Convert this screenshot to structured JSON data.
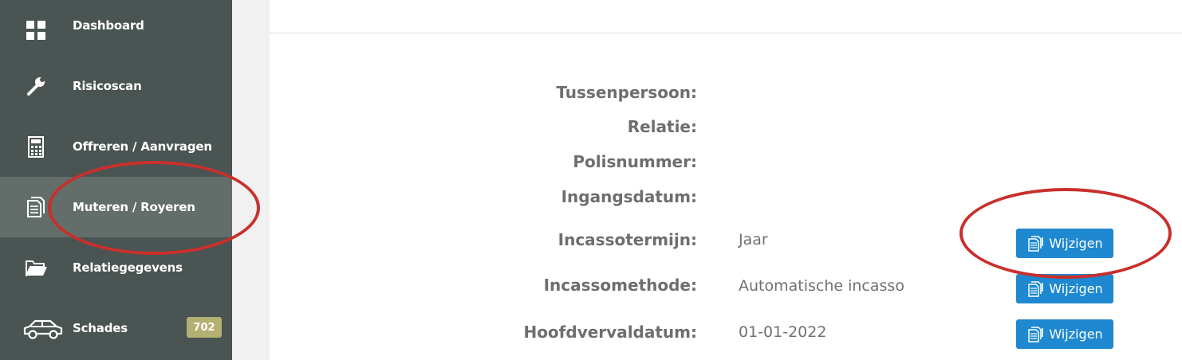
{
  "sidebar": {
    "items": [
      {
        "label": "Dashboard",
        "icon": "dashboard-icon",
        "active": false
      },
      {
        "label": "Risicoscan",
        "icon": "wrench-icon",
        "active": false
      },
      {
        "label": "Offreren / Aanvragen",
        "icon": "calculator-icon",
        "active": false
      },
      {
        "label": "Muteren / Royeren",
        "icon": "documents-icon",
        "active": true
      },
      {
        "label": "Relatiegegevens",
        "icon": "folder-icon",
        "active": false
      },
      {
        "label": "Schades",
        "icon": "car-icon",
        "active": false,
        "badge": "702"
      }
    ]
  },
  "details": {
    "tussenpersoon_label": "Tussenpersoon:",
    "relatie_label": "Relatie:",
    "polisnummer_label": "Polisnummer:",
    "ingangsdatum_label": "Ingangsdatum:",
    "incassotermijn_label": "Incassotermijn:",
    "incassotermijn_value": "Jaar",
    "incassomethode_label": "Incassomethode:",
    "incassomethode_value": "Automatische incasso",
    "hoofdvervaldatum_label": "Hoofdvervaldatum:",
    "hoofdvervaldatum_value": "01-01-2022",
    "edit_label": "Wijzigen"
  },
  "colors": {
    "sidebar_bg": "#4a5452",
    "sidebar_active": "#636e6b",
    "badge": "#b4b072",
    "button": "#1e88d0",
    "annotation": "#c8302c"
  }
}
